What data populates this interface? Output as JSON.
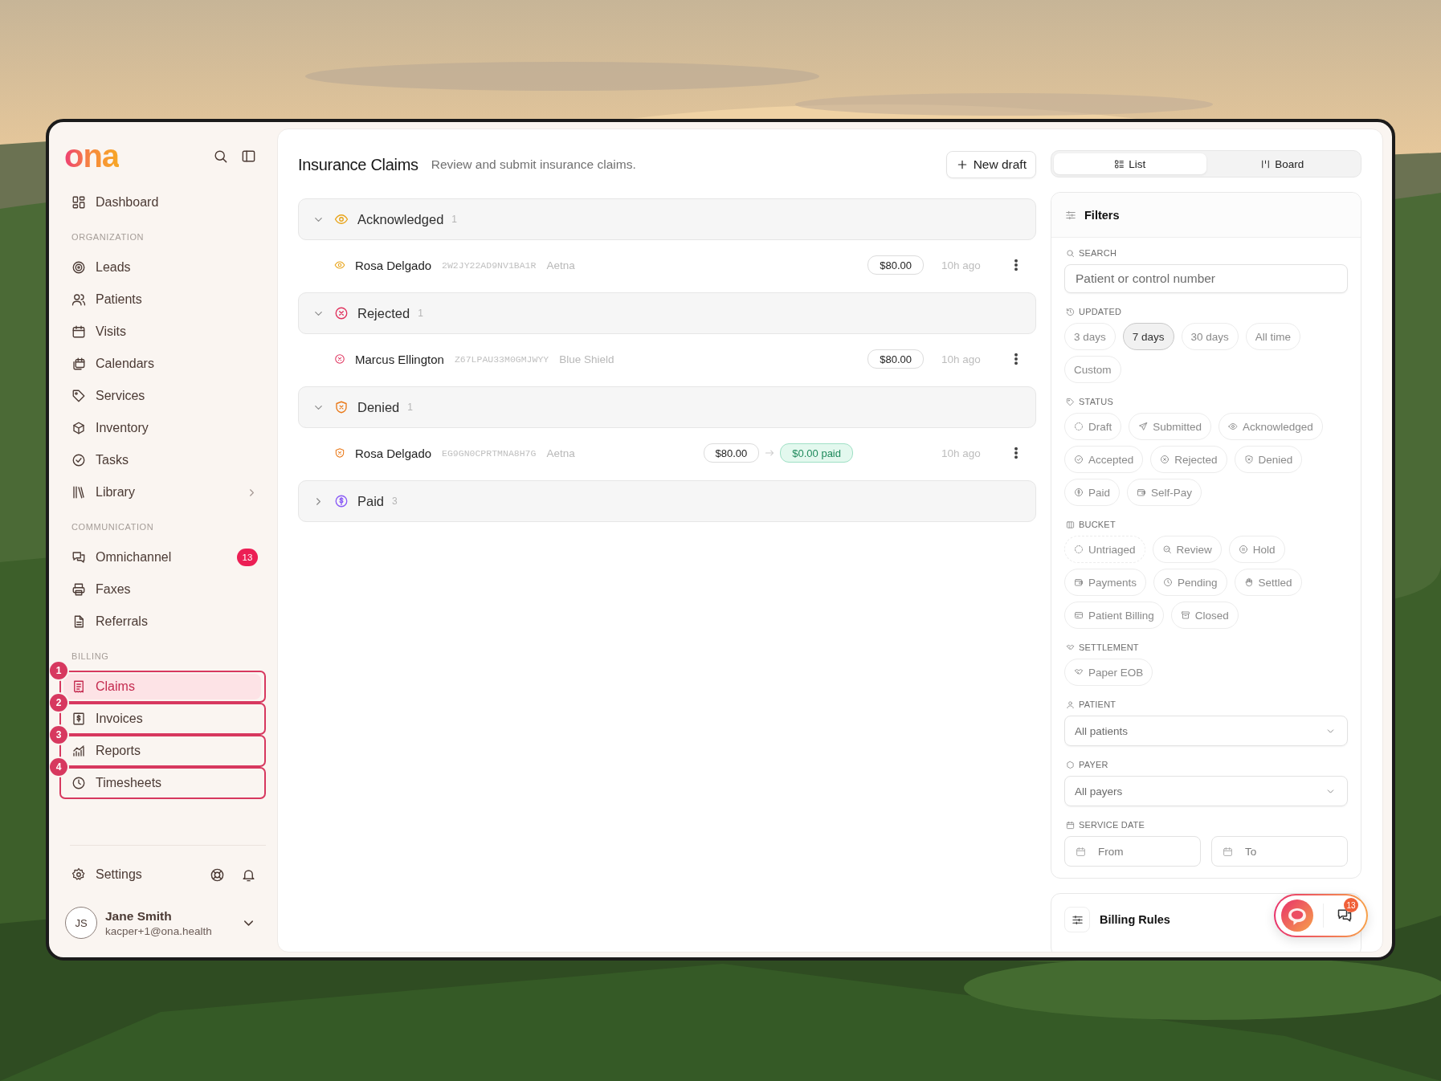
{
  "sidebar": {
    "logo": "ona",
    "sections": [
      {
        "items": [
          {
            "label": "Dashboard",
            "selected": false,
            "submenu": false
          }
        ]
      },
      {
        "heading": "ORGANIZATION",
        "items": [
          {
            "label": "Leads",
            "selected": false,
            "submenu": false
          },
          {
            "label": "Patients",
            "selected": false,
            "submenu": false
          },
          {
            "label": "Visits",
            "selected": false,
            "submenu": false
          },
          {
            "label": "Calendars",
            "selected": false,
            "submenu": false
          },
          {
            "label": "Services",
            "selected": false,
            "submenu": false
          },
          {
            "label": "Inventory",
            "selected": false,
            "submenu": false
          },
          {
            "label": "Tasks",
            "selected": false,
            "submenu": false
          },
          {
            "label": "Library",
            "selected": false,
            "submenu": true
          }
        ]
      },
      {
        "heading": "COMMUNICATION",
        "items": [
          {
            "label": "Omnichannel",
            "selected": false,
            "submenu": false,
            "badge": "13"
          },
          {
            "label": "Faxes",
            "selected": false,
            "submenu": false
          },
          {
            "label": "Referrals",
            "selected": false,
            "submenu": false
          }
        ]
      },
      {
        "heading": "BILLING",
        "items": [
          {
            "label": "Claims",
            "selected": true,
            "submenu": false,
            "marker": "1"
          },
          {
            "label": "Invoices",
            "selected": false,
            "submenu": false,
            "marker": "2"
          },
          {
            "label": "Reports",
            "selected": false,
            "submenu": false,
            "marker": "3"
          },
          {
            "label": "Timesheets",
            "selected": false,
            "submenu": false,
            "marker": "4"
          }
        ]
      }
    ],
    "settings": "Settings",
    "user": {
      "initials": "JS",
      "name": "Jane Smith",
      "email": "kacper+1@ona.health"
    }
  },
  "page": {
    "title": "Insurance Claims",
    "subtitle": "Review and submit insurance claims.",
    "new_draft": "New draft"
  },
  "groups": [
    {
      "kind": "acknowledged",
      "label": "Acknowledged",
      "count": "1",
      "expanded": true,
      "claims": [
        {
          "patient": "Rosa Delgado",
          "control_number": "2W2JY22AD9NV1BA1R",
          "payer": "Aetna",
          "amount": "$80.00",
          "time": "10h ago"
        }
      ]
    },
    {
      "kind": "rejected",
      "label": "Rejected",
      "count": "1",
      "expanded": true,
      "claims": [
        {
          "patient": "Marcus Ellington",
          "control_number": "Z67LPAU33M0GMJWYY",
          "payer": "Blue Shield",
          "amount": "$80.00",
          "time": "10h ago"
        }
      ]
    },
    {
      "kind": "denied",
      "label": "Denied",
      "count": "1",
      "expanded": true,
      "claims": [
        {
          "patient": "Rosa Delgado",
          "control_number": "EG9GN0CPRTMNA8H7G",
          "payer": "Aetna",
          "amount": "$80.00",
          "paid": "$0.00 paid",
          "time": "10h ago"
        }
      ]
    },
    {
      "kind": "paid",
      "label": "Paid",
      "count": "3",
      "expanded": false
    }
  ],
  "view_toggle": [
    {
      "label": "List",
      "selected": true
    },
    {
      "label": "Board",
      "selected": false
    }
  ],
  "filters": {
    "title": "Filters",
    "sections": [
      {
        "kind": "search",
        "label": "SEARCH",
        "placeholder": "Patient or control number"
      },
      {
        "kind": "chips",
        "label": "UPDATED",
        "chips": [
          {
            "label": "3 days",
            "selected": false
          },
          {
            "label": "7 days",
            "selected": true
          },
          {
            "label": "30 days",
            "selected": false
          },
          {
            "label": "All time",
            "selected": false
          },
          {
            "label": "Custom",
            "selected": false
          }
        ]
      },
      {
        "kind": "chips",
        "label": "STATUS",
        "chips": [
          {
            "label": "Draft",
            "selected": false
          },
          {
            "label": "Submitted",
            "selected": false
          },
          {
            "label": "Acknowledged",
            "selected": false
          },
          {
            "label": "Accepted",
            "selected": false
          },
          {
            "label": "Rejected",
            "selected": false
          },
          {
            "label": "Denied",
            "selected": false
          },
          {
            "label": "Paid",
            "selected": false
          },
          {
            "label": "Self-Pay",
            "selected": false
          }
        ]
      },
      {
        "kind": "chips",
        "label": "BUCKET",
        "chips": [
          {
            "label": "Untriaged",
            "selected": false
          },
          {
            "label": "Review",
            "selected": false
          },
          {
            "label": "Hold",
            "selected": false
          },
          {
            "label": "Payments",
            "selected": false
          },
          {
            "label": "Pending",
            "selected": false
          },
          {
            "label": "Settled",
            "selected": false
          },
          {
            "label": "Patient Billing",
            "selected": false
          },
          {
            "label": "Closed",
            "selected": false
          }
        ]
      },
      {
        "kind": "chips",
        "label": "SETTLEMENT",
        "chips": [
          {
            "label": "Paper EOB",
            "selected": false
          }
        ]
      },
      {
        "kind": "select",
        "label": "PATIENT",
        "value": "All patients"
      },
      {
        "kind": "select",
        "label": "PAYER",
        "value": "All payers"
      },
      {
        "kind": "date_range",
        "label": "SERVICE DATE",
        "from": "From",
        "to": "To"
      }
    ]
  },
  "billing_rules": {
    "title": "Billing Rules"
  },
  "chat_widget": {
    "badge": "13"
  }
}
